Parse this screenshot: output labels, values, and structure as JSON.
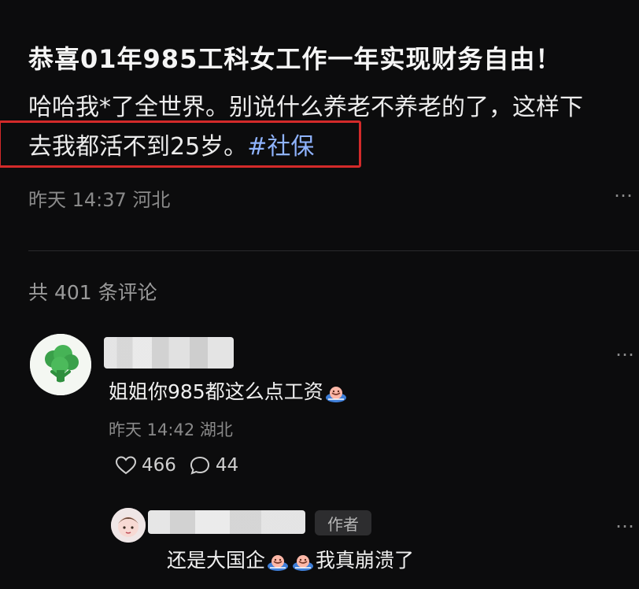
{
  "post": {
    "title": "恭喜01年985工科女工作一年实现财务自由！",
    "body_line1": "哈哈我*了全世界。别说什么养老不养老的了，这样下",
    "body_line2": "去我都活不到25岁。",
    "hashtag": "#社保",
    "meta": "昨天 14:37 河北",
    "more_icon": "…"
  },
  "comments": {
    "count_label": "共 401 条评论",
    "items": [
      {
        "avatar_icon": "broccoli-icon",
        "text": "姐姐你985都这么点工资",
        "emoji": "sweat-smile-emoji",
        "meta": "昨天 14:42 湖北",
        "likes": "466",
        "replies": "44",
        "more_icon": "…"
      }
    ],
    "reply": {
      "author_badge": "作者",
      "text_part1": "还是大国企",
      "text_part2": "我真崩溃了",
      "more_icon": "…"
    }
  },
  "colors": {
    "background": "#0c0c0d",
    "hashtag": "#8fb3ff",
    "highlight": "#d42a2a"
  }
}
